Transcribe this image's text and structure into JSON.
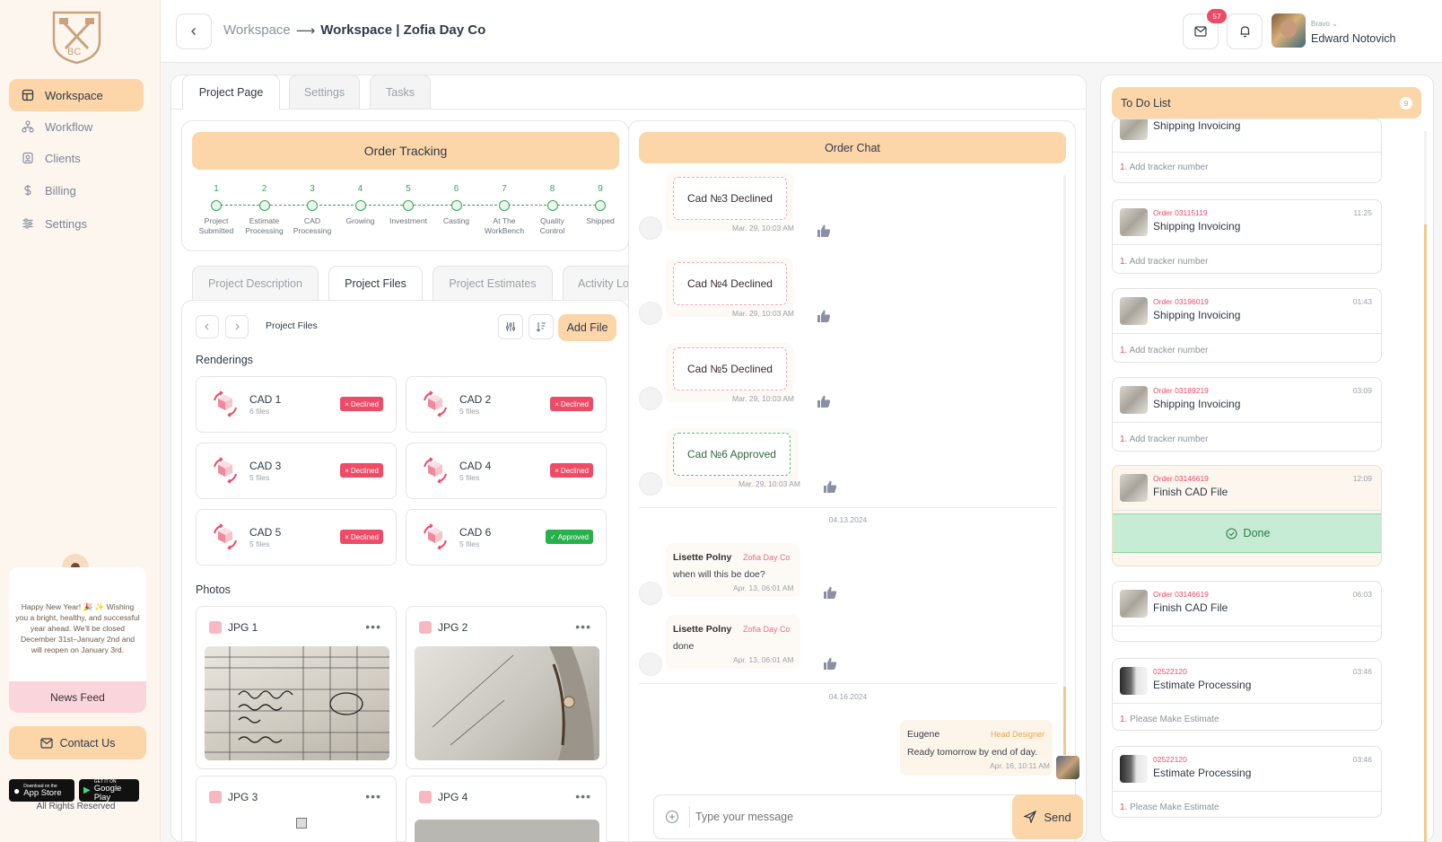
{
  "sidebar": {
    "logo_text": "BC",
    "nav": [
      {
        "label": "Workspace",
        "icon": "workspace-icon",
        "active": true
      },
      {
        "label": "Workflow",
        "icon": "workflow-icon",
        "active": false
      },
      {
        "label": "Clients",
        "icon": "clients-icon",
        "active": false
      },
      {
        "label": "Billing",
        "icon": "dollar-icon",
        "active": false
      },
      {
        "label": "Settings",
        "icon": "sliders-icon",
        "active": false
      }
    ],
    "news_text": "Happy New Year! 🎉 ✨ Wishing you a bright, healthy, and successful year ahead. We'll be closed December 31st–January 2nd and will reopen on January 3rd.",
    "news_button": "News Feed",
    "contact_button": "Contact Us",
    "app_store_small": "Download on the",
    "app_store": "App Store",
    "google_play_small": "GET IT ON",
    "google_play": "Google Play",
    "footer": "All Rights Reserved"
  },
  "header": {
    "crumb_root": "Workspace",
    "crumb_arrow": "⟶",
    "crumb_current": "Workspace | Zofia Day Co",
    "mail_badge": "57",
    "user_role": "Bravo",
    "user_name": "Edward Notovich"
  },
  "tabs": [
    "Project Page",
    "Settings",
    "Tasks"
  ],
  "order_tracking": {
    "title": "Order Tracking",
    "steps": [
      {
        "num": "1",
        "label": "Project Submitted"
      },
      {
        "num": "2",
        "label": "Estimate Processing"
      },
      {
        "num": "3",
        "label": "CAD Processing"
      },
      {
        "num": "4",
        "label": "Growing"
      },
      {
        "num": "5",
        "label": "Investment"
      },
      {
        "num": "6",
        "label": "Casting"
      },
      {
        "num": "7",
        "label": "At The WorkBench"
      },
      {
        "num": "8",
        "label": "Quality Control"
      },
      {
        "num": "9",
        "label": "Shipped"
      }
    ]
  },
  "subtabs": [
    "Project Description",
    "Project Files",
    "Project Estimates",
    "Activity Lo"
  ],
  "files": {
    "breadcrumb": "Project Files",
    "add_button": "Add File",
    "renderings_title": "Renderings",
    "renderings": [
      {
        "name": "CAD 1",
        "files": "6 files",
        "status": "Declined"
      },
      {
        "name": "CAD 2",
        "files": "5 files",
        "status": "Declined"
      },
      {
        "name": "CAD 3",
        "files": "5 files",
        "status": "Declined"
      },
      {
        "name": "CAD 4",
        "files": "5 files",
        "status": "Declined"
      },
      {
        "name": "CAD 5",
        "files": "5 files",
        "status": "Declined"
      },
      {
        "name": "CAD 6",
        "files": "5 files",
        "status": "Approved"
      }
    ],
    "photos_title": "Photos",
    "photos": [
      {
        "name": "JPG 1"
      },
      {
        "name": "JPG 2"
      },
      {
        "name": "JPG 3"
      },
      {
        "name": "JPG 4"
      }
    ],
    "status_icons": {
      "declined": "×",
      "approved": "✓"
    },
    "more_glyph": "•••"
  },
  "chat": {
    "title": "Order Chat",
    "cad_messages": [
      {
        "text": "Cad №3 Declined",
        "time": "Mar. 29, 10:03 AM"
      },
      {
        "text": "Cad №4 Declined",
        "time": "Mar. 29, 10:03 AM"
      },
      {
        "text": "Cad №5 Declined",
        "time": "Mar. 29, 10:03 AM"
      },
      {
        "text": "Cad №6 Approved",
        "time": "Mar. 29, 10:03 AM"
      }
    ],
    "date1": "04.13.2024",
    "messages": [
      {
        "sender": "Lisette Polny",
        "company": "Zofia Day Co",
        "text": "when will this be doe?",
        "time": "Apr. 13, 06:01 AM"
      },
      {
        "sender": "Lisette Polny",
        "company": "Zofia Day Co",
        "text": "done",
        "time": "Apr. 13, 06:01 AM"
      }
    ],
    "date2": "04.16.2024",
    "own_message": {
      "sender": "Eugene",
      "role": "Head Designer",
      "text": "Ready tomorrow by end of day.",
      "time": "Apr. 16, 10:11 AM"
    },
    "input_placeholder": "Type your message",
    "send": "Send"
  },
  "todo": {
    "title": "To Do List",
    "count": "9",
    "items": [
      {
        "order": "",
        "title": "Shipping Invoicing",
        "time": "",
        "sub_num": "1.",
        "sub": "Add tracker number"
      },
      {
        "order": "Order 03115119",
        "title": "Shipping Invoicing",
        "time": "11:25",
        "sub_num": "1.",
        "sub": "Add tracker number"
      },
      {
        "order": "Order 03196019",
        "title": "Shipping Invoicing",
        "time": "01:43",
        "sub_num": "1.",
        "sub": "Add tracker number"
      },
      {
        "order": "Order 03189219",
        "title": "Shipping Invoicing",
        "time": "03:09",
        "sub_num": "1.",
        "sub": "Add tracker number"
      },
      {
        "order": "Order 03146619",
        "title": "Finish CAD File",
        "time": "12:09",
        "done": "Done"
      },
      {
        "order": "Order 03146619",
        "title": "Finish CAD File",
        "time": "06:03"
      },
      {
        "order": "02522120",
        "title": "Estimate Processing",
        "time": "03:46",
        "sub_num": "1.",
        "sub": "Please Make Estimate"
      },
      {
        "order": "02522120",
        "title": "Estimate Processing",
        "time": "03:46",
        "sub_num": "1.",
        "sub": "Please Make Estimate"
      }
    ]
  }
}
